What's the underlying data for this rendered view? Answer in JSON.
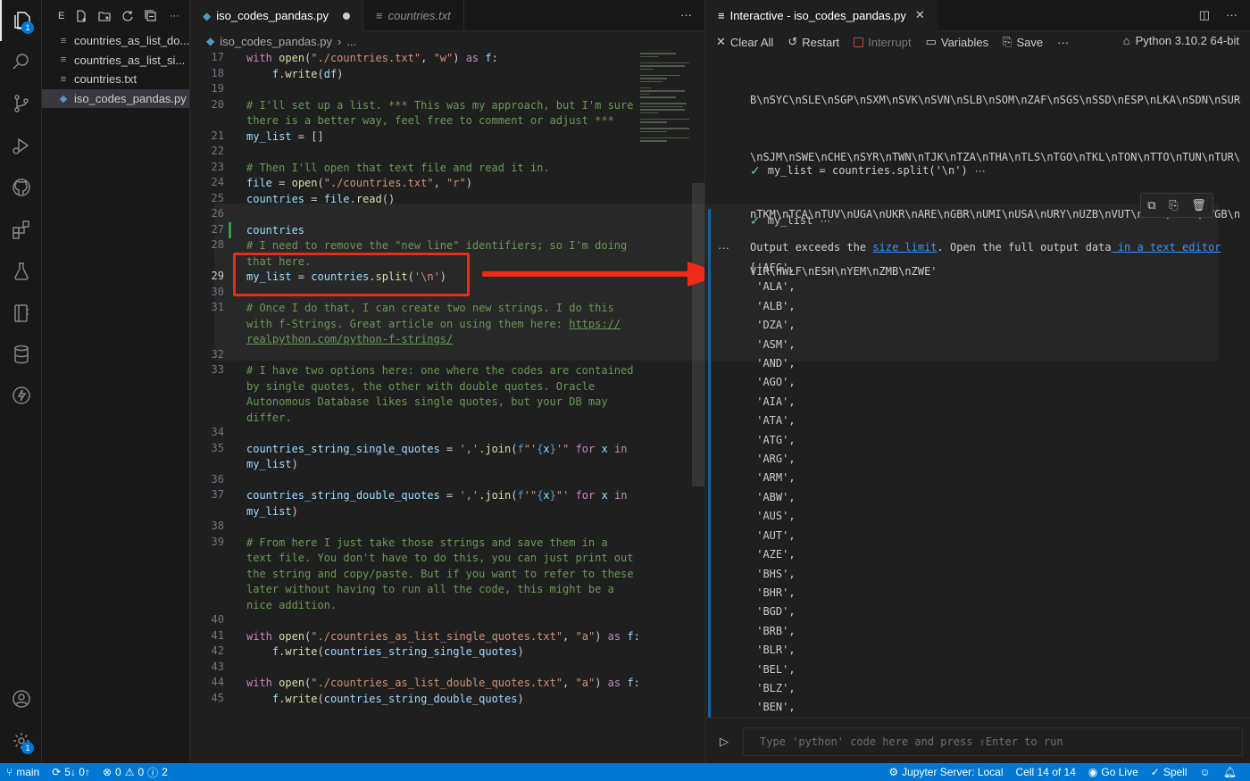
{
  "colors": {
    "accent": "#0078d4",
    "annotation": "#ee2a18",
    "check": "#73c991",
    "link": "#3794ff"
  },
  "activity_bar": {
    "explorer_badge": "1",
    "settings_badge": "1"
  },
  "explorer": {
    "header_letter": "E",
    "files": [
      {
        "name": "countries_as_list_do...",
        "icon": "text-file-icon"
      },
      {
        "name": "countries_as_list_si...",
        "icon": "text-file-icon"
      },
      {
        "name": "countries.txt",
        "icon": "text-file-icon"
      },
      {
        "name": "iso_codes_pandas.py",
        "icon": "python-file-icon",
        "selected": true
      }
    ]
  },
  "editor": {
    "tabs": [
      {
        "label": "iso_codes_pandas.py",
        "active": true
      },
      {
        "label": "countries.txt",
        "active": false
      }
    ],
    "breadcrumb": {
      "file": "iso_codes_pandas.py",
      "more": "..."
    },
    "more": "···",
    "line_numbers": [
      "17",
      "18",
      "19",
      "20",
      "21",
      "22",
      "23",
      "24",
      "25",
      "26",
      "27",
      "28",
      "29",
      "30",
      "31",
      "32",
      "33",
      "34",
      "35",
      "36",
      "37",
      "38",
      "39",
      "40",
      "41",
      "42",
      "43",
      "44",
      "45"
    ],
    "current_line": "29"
  },
  "panel": {
    "tab_title": "Interactive - iso_codes_pandas.py",
    "toolbar": {
      "clear": "Clear All",
      "restart": "Restart",
      "interrupt": "Interrupt",
      "variables": "Variables",
      "save": "Save",
      "more": "···",
      "kernel": "Python 3.10.2 64-bit"
    },
    "previous_output": [
      "B\\nSYC\\nSLE\\nSGP\\nSXM\\nSVK\\nSVN\\nSLB\\nSOM\\nZAF\\nSGS\\nSSD\\nESP\\nLKA\\nSDN\\nSUR",
      "\\nSJM\\nSWE\\nCHE\\nSYR\\nTWN\\nTJK\\nTZA\\nTHA\\nTLS\\nTGO\\nTKL\\nTON\\nTTO\\nTUN\\nTUR\\",
      "nTKM\\nTCA\\nTUV\\nUGA\\nUKR\\nARE\\nGBR\\nUMI\\nUSA\\nURY\\nUZB\\nVUT\\nVEN\\nVNM\\nVGB\\n",
      "VIR\\nWLF\\nESH\\nYEM\\nZMB\\nZWE'"
    ],
    "cells": [
      {
        "code": "my_list = countries.split('\\n')",
        "more": "···"
      },
      {
        "code": "my_list",
        "more": "···"
      }
    ],
    "output_message": {
      "prefix": "Output exceeds the ",
      "link1": "size limit",
      "middle": ". Open the full output data",
      "link2": " in a text editor"
    },
    "output_list": [
      "['AFG',",
      " 'ALA',",
      " 'ALB',",
      " 'DZA',",
      " 'ASM',",
      " 'AND',",
      " 'AGO',",
      " 'AIA',",
      " 'ATA',",
      " 'ATG',",
      " 'ARG',",
      " 'ARM',",
      " 'ABW',",
      " 'AUS',",
      " 'AUT',",
      " 'AZE',",
      " 'BHS',",
      " 'BHR',",
      " 'BGD',",
      " 'BRB',",
      " 'BLR',",
      " 'BEL',",
      " 'BLZ',",
      " 'BEN',"
    ],
    "input_placeholder": "Type 'python' code here and press ⇧Enter to run"
  },
  "status_bar": {
    "branch": "main",
    "sync": "5↓ 0↑",
    "errors": "0",
    "warnings": "0",
    "info": "2",
    "jupyter": "Jupyter Server: Local",
    "cell": "Cell 14 of 14",
    "go_live": "Go Live",
    "spell": "Spell"
  }
}
